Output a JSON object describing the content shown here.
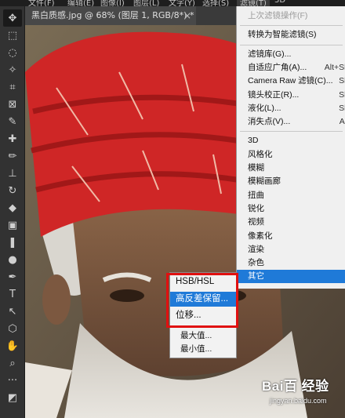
{
  "menubar": {
    "items": [
      "文件(F)",
      "编辑(E)",
      "图像(I)",
      "图层(L)",
      "文字(Y)",
      "选择(S)",
      "滤镜(T)",
      "3D"
    ],
    "active": "滤镜(T)"
  },
  "document_tab": {
    "title": "黑白质感.jpg @ 68% (图层 1, RGB/8*) *",
    "close": "×"
  },
  "toolbar": {
    "tools": [
      "move-tool",
      "marquee-tool",
      "lasso-tool",
      "magic-wand-tool",
      "crop-tool",
      "frame-tool",
      "eyedropper-tool",
      "healing-brush-tool",
      "brush-tool",
      "stamp-tool",
      "history-brush-tool",
      "eraser-tool",
      "gradient-tool",
      "blur-tool",
      "dodge-tool",
      "pen-tool",
      "type-tool",
      "path-selection-tool",
      "shape-tool",
      "hand-tool",
      "zoom-tool",
      "more-tools",
      "colors-tool"
    ],
    "glyphs": [
      "✥",
      "⬚",
      "◌",
      "✧",
      "⌗",
      "⊠",
      "✎",
      "✚",
      "✏",
      "⊥",
      "↻",
      "◆",
      "▣",
      "❚",
      "●",
      "✒",
      "T",
      "↖",
      "⬡",
      "✋",
      "⌕",
      "···",
      "◩"
    ],
    "selected_index": 0
  },
  "filter_menu": {
    "items": [
      {
        "label": "上次滤镜操作(F)",
        "disabled": true
      },
      {
        "separator": true
      },
      {
        "label": "转换为智能滤镜(S)"
      },
      {
        "separator": true
      },
      {
        "label": "滤镜库(G)..."
      },
      {
        "label": "自适应广角(A)...",
        "shortcut": "Alt+Sh"
      },
      {
        "label": "Camera Raw 滤镜(C)...",
        "shortcut": "Sh"
      },
      {
        "label": "镜头校正(R)...",
        "shortcut": "Sh"
      },
      {
        "label": "液化(L)...",
        "shortcut": "Sh"
      },
      {
        "label": "消失点(V)...",
        "shortcut": "Alt"
      },
      {
        "separator": true
      },
      {
        "label": "3D"
      },
      {
        "label": "风格化"
      },
      {
        "label": "模糊"
      },
      {
        "label": "模糊画廊"
      },
      {
        "label": "扭曲"
      },
      {
        "label": "锐化"
      },
      {
        "label": "视频"
      },
      {
        "label": "像素化"
      },
      {
        "label": "渲染"
      },
      {
        "label": "杂色"
      },
      {
        "label": "其它",
        "highlighted": true
      }
    ]
  },
  "sub_menu": {
    "items": [
      {
        "label": "HSB/HSL"
      },
      {
        "label": "高反差保留...",
        "highlighted": true
      },
      {
        "label": "位移..."
      },
      {
        "separator": true
      },
      {
        "label": "最大值..."
      },
      {
        "label": "最小值..."
      }
    ]
  },
  "watermark": {
    "logo": "Bai百 经验",
    "url": "jingyan.baidu.com"
  },
  "colors": {
    "highlight": "#1f7ad8",
    "annotation": "#e01010",
    "turban": "#d12a2a"
  }
}
